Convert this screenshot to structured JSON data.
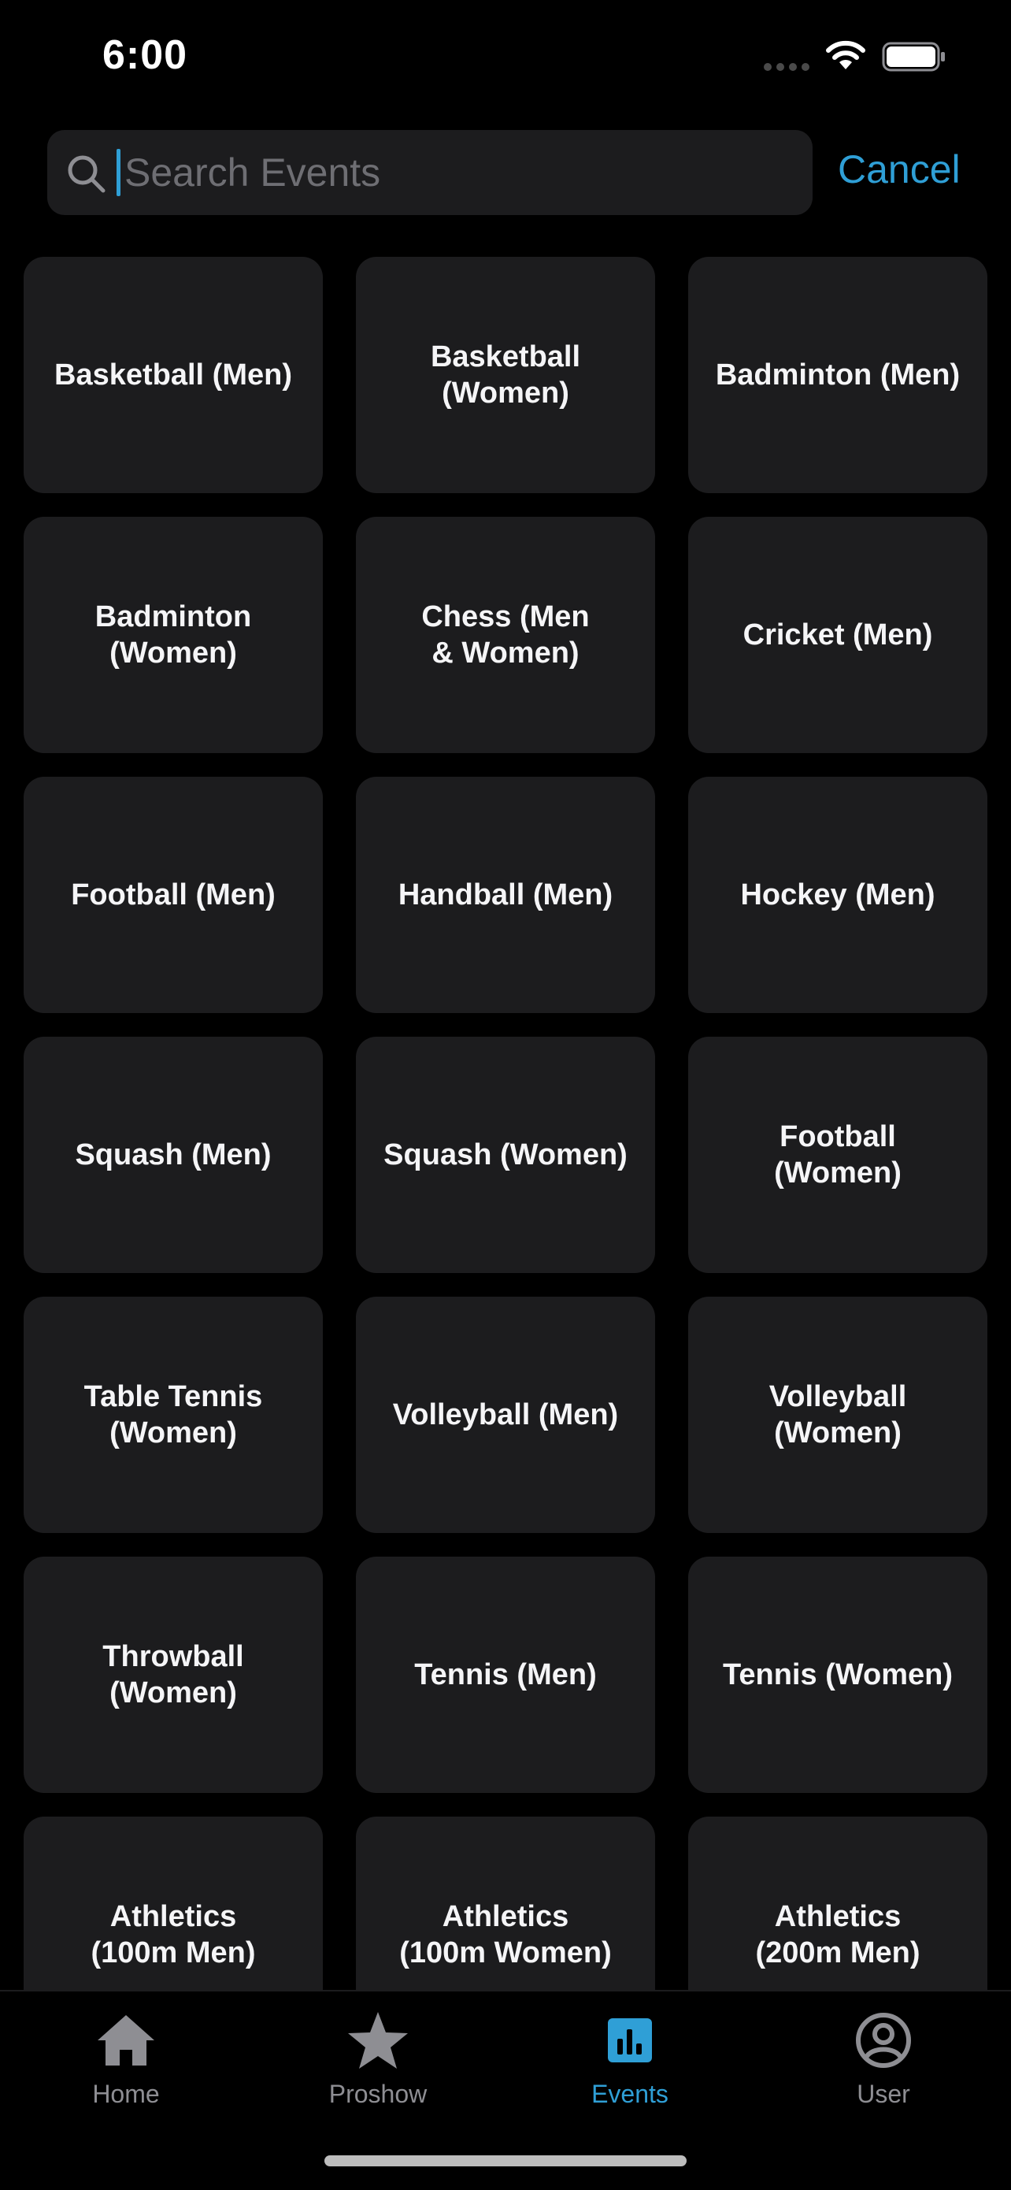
{
  "status_bar": {
    "time": "6:00"
  },
  "search": {
    "placeholder": "Search Events",
    "value": "",
    "cancel_label": "Cancel"
  },
  "events": [
    "Basketball (Men)",
    "Basketball\n(Women)",
    "Badminton (Men)",
    "Badminton\n(Women)",
    "Chess (Men\n& Women)",
    "Cricket (Men)",
    "Football (Men)",
    "Handball (Men)",
    "Hockey (Men)",
    "Squash (Men)",
    "Squash (Women)",
    "Football\n(Women)",
    "Table Tennis\n(Women)",
    "Volleyball (Men)",
    "Volleyball\n(Women)",
    "Throwball\n(Women)",
    "Tennis (Men)",
    "Tennis (Women)",
    "Athletics\n(100m Men)",
    "Athletics\n(100m Women)",
    "Athletics\n(200m Men)"
  ],
  "tab_bar": {
    "tabs": [
      {
        "label": "Home",
        "icon": "house-icon",
        "active": false
      },
      {
        "label": "Proshow",
        "icon": "star-icon",
        "active": false
      },
      {
        "label": "Events",
        "icon": "bar-chart-icon",
        "active": true
      },
      {
        "label": "User",
        "icon": "user-circle-icon",
        "active": false
      }
    ]
  },
  "colors": {
    "background": "#000000",
    "tile": "#1c1c1e",
    "accent": "#2f9fd6",
    "inactive": "#8e8e93"
  }
}
